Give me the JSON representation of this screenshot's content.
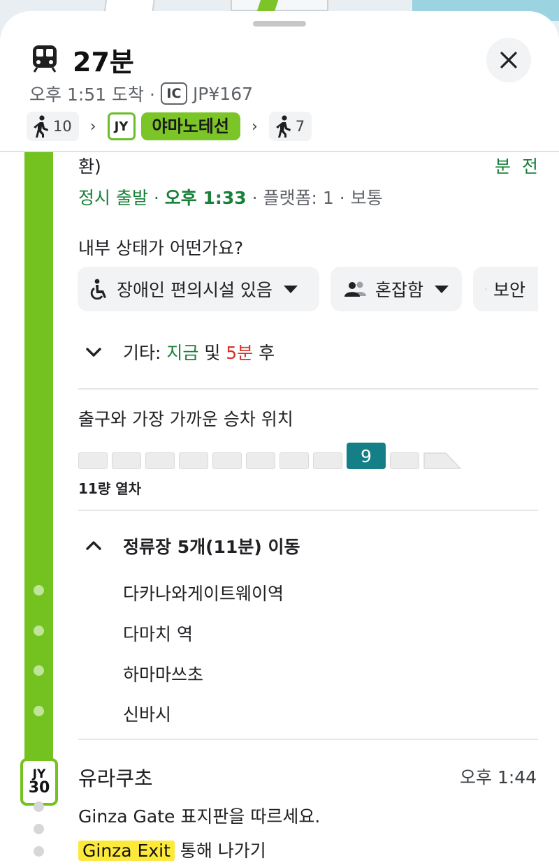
{
  "header": {
    "duration": "27분",
    "arrival": "오후 1:51 도착 ·",
    "ic_label": "IC",
    "fare": "JP¥167",
    "steps": {
      "walk_start": "10",
      "line_code": "JY",
      "line_name": "야마노테선",
      "walk_end": "7",
      "separator": "›"
    }
  },
  "departure": {
    "partial_top": "환)",
    "right_minutes": "분 전",
    "status_ontime": "정시 출발",
    "dot1": " · ",
    "time": "오후 1:33",
    "platform": " · 플랫폼: 1 · 보통"
  },
  "crowd": {
    "question": "내부 상태가 어떤가요?",
    "chips": [
      {
        "label": "장애인 편의시설 있음",
        "icon": "wheelchair-icon"
      },
      {
        "label": "혼잡함",
        "icon": "people-icon"
      },
      {
        "label": "보안",
        "icon": "shield-icon"
      }
    ]
  },
  "other_departures": {
    "prefix": "기타: ",
    "now": "지금",
    "and": " 및 ",
    "minutes": "5분",
    "suffix": " 후"
  },
  "boarding": {
    "title": "출구와 가장 가까운 승차 위치",
    "highlight_car": "9",
    "train_length": "11량 열차"
  },
  "intermediate": {
    "header": "정류장 5개(11분) 이동",
    "stops": [
      "다카나와게이트웨이역",
      "다마치 역",
      "하마마쓰초",
      "신바시"
    ]
  },
  "arrival_stop": {
    "line_code": "JY",
    "number": "30",
    "name": "유라쿠초",
    "time": "오후 1:44",
    "instruction": "Ginza Gate 표지판을 따르세요.",
    "exit_label": "Ginza Exit",
    "exit_suffix": " 통해 나가기"
  },
  "colors": {
    "line_green": "#73c21f",
    "ontime_green": "#188038",
    "late_red": "#d93025",
    "car_teal": "#147f86",
    "exit_yellow": "#fde93a"
  }
}
